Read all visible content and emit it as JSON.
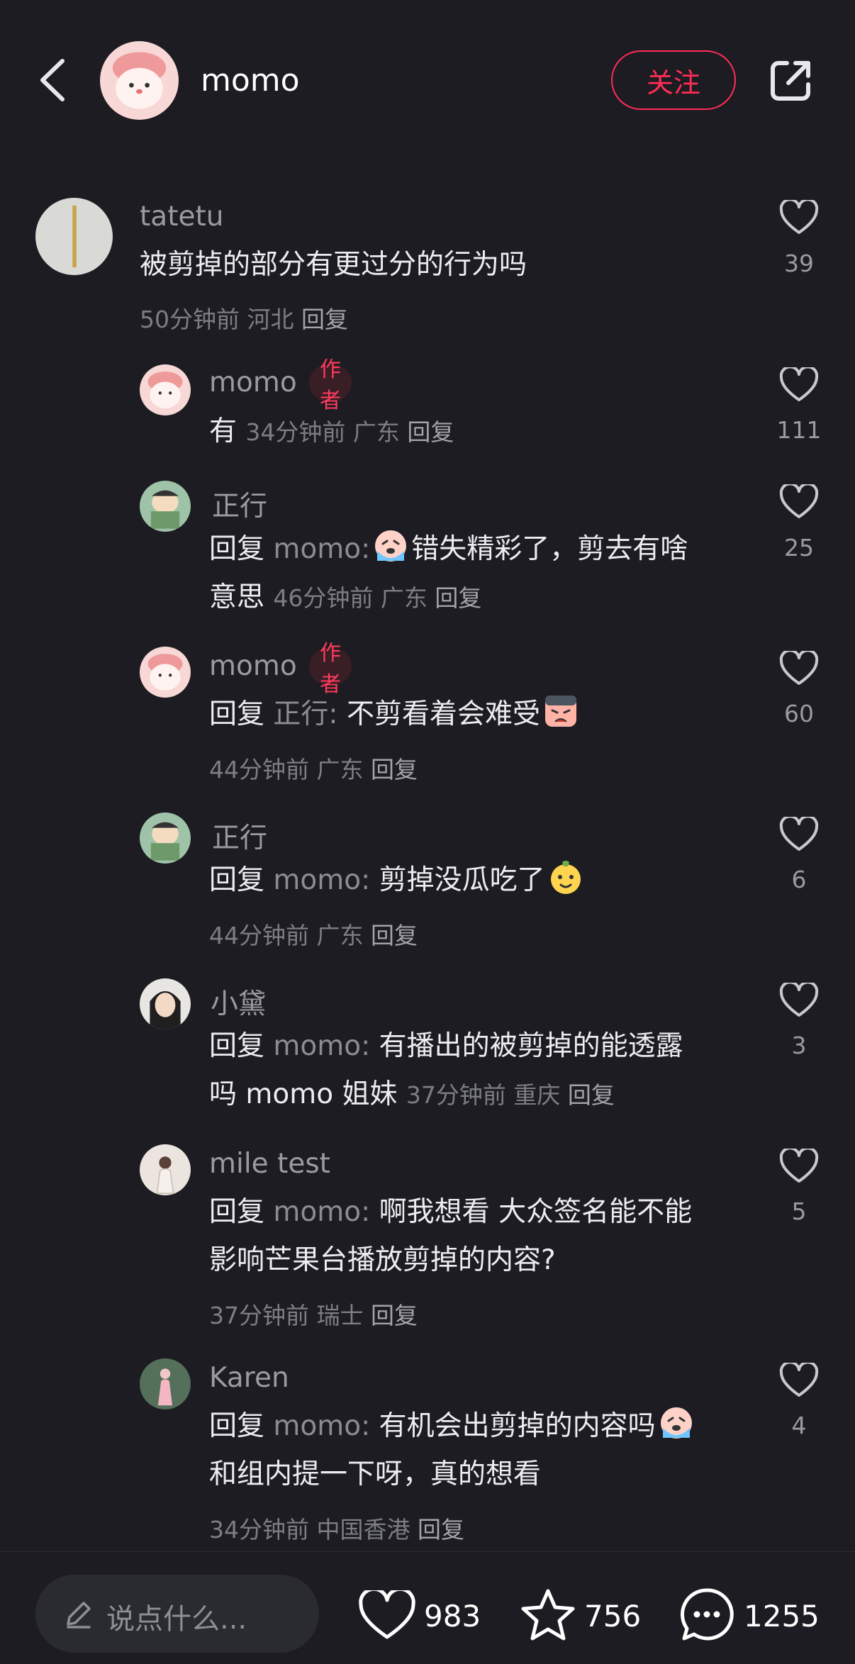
{
  "header": {
    "name": "momo",
    "follow_label": "关注"
  },
  "comments": [
    {
      "user": "tatetu",
      "text": "被剪掉的部分有更过分的行为吗",
      "time": "50分钟前",
      "location": "河北",
      "reply_label": "回复",
      "likes": "39"
    },
    {
      "user": "momo",
      "author_tag": "作者",
      "text": "有",
      "time": "34分钟前",
      "location": "广东",
      "reply_label": "回复",
      "likes": "111"
    },
    {
      "user": "正行",
      "reply_prefix": "回复",
      "reply_to": "momo:",
      "text_a": "错失精彩了，剪去有啥",
      "text_b": "意思",
      "time": "46分钟前",
      "location": "广东",
      "reply_label": "回复",
      "likes": "25",
      "emoji": "crying-emoji"
    },
    {
      "user": "momo",
      "author_tag": "作者",
      "reply_prefix": "回复",
      "reply_to": "正行:",
      "text": "不剪看着会难受",
      "time": "44分钟前",
      "location": "广东",
      "reply_label": "回复",
      "likes": "60",
      "emoji": "sad-face-emoji"
    },
    {
      "user": "正行",
      "reply_prefix": "回复",
      "reply_to": "momo:",
      "text": "剪掉没瓜吃了",
      "time": "44分钟前",
      "location": "广东",
      "reply_label": "回复",
      "likes": "6",
      "emoji": "melon-eating-emoji"
    },
    {
      "user": "小黛",
      "reply_prefix": "回复",
      "reply_to": "momo:",
      "text_a": "有播出的被剪掉的能透露",
      "text_b": "吗 momo 姐妹",
      "time": "37分钟前",
      "location": "重庆",
      "reply_label": "回复",
      "likes": "3"
    },
    {
      "user": "mile test",
      "reply_prefix": "回复",
      "reply_to": "momo:",
      "text_a": "啊我想看 大众签名能不能",
      "text_b": "影响芒果台播放剪掉的内容?",
      "time": "37分钟前",
      "location": "瑞士",
      "reply_label": "回复",
      "likes": "5"
    },
    {
      "user": "Karen",
      "reply_prefix": "回复",
      "reply_to": "momo:",
      "text_a": "有机会出剪掉的内容吗",
      "text_b": "和组内提一下呀，真的想看",
      "time": "34分钟前",
      "location": "中国香港",
      "reply_label": "回复",
      "likes": "4",
      "emoji": "crying-emoji"
    }
  ],
  "bottom": {
    "placeholder": "说点什么...",
    "likes": "983",
    "stars": "756",
    "comments": "1255"
  },
  "colors": {
    "accent": "#ff2d55",
    "background": "#1c1c22"
  }
}
